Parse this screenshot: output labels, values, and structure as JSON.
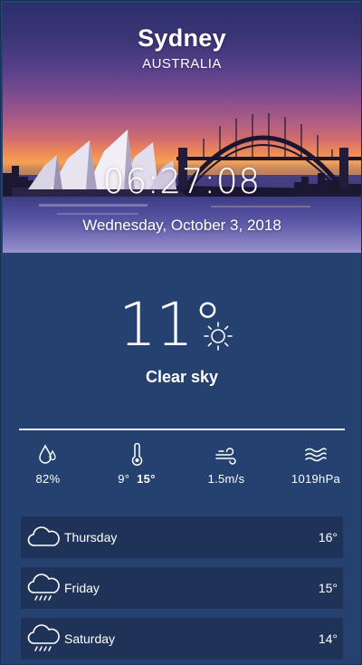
{
  "header": {
    "city": "Sydney",
    "country": "AUSTRALIA",
    "time": "06:27:08",
    "date": "Wednesday, October 3, 2018"
  },
  "current": {
    "temperature": "11°",
    "condition": "Clear sky",
    "condition_icon": "sun-icon"
  },
  "stats": [
    {
      "icon": "humidity-icon",
      "value": "82%"
    },
    {
      "icon": "thermometer-icon",
      "low": "9°",
      "high": "15°"
    },
    {
      "icon": "wind-icon",
      "value": "1.5m/s"
    },
    {
      "icon": "pressure-icon",
      "value": "1019hPa"
    }
  ],
  "forecast": [
    {
      "day": "Thursday",
      "high": "16°",
      "icon": "cloud-icon"
    },
    {
      "day": "Friday",
      "high": "15°",
      "icon": "rain-cloud-icon"
    },
    {
      "day": "Saturday",
      "high": "14°",
      "icon": "rain-cloud-icon"
    }
  ],
  "colors": {
    "background": "#25416f",
    "card": "#1f3358",
    "text": "#ffffff"
  }
}
